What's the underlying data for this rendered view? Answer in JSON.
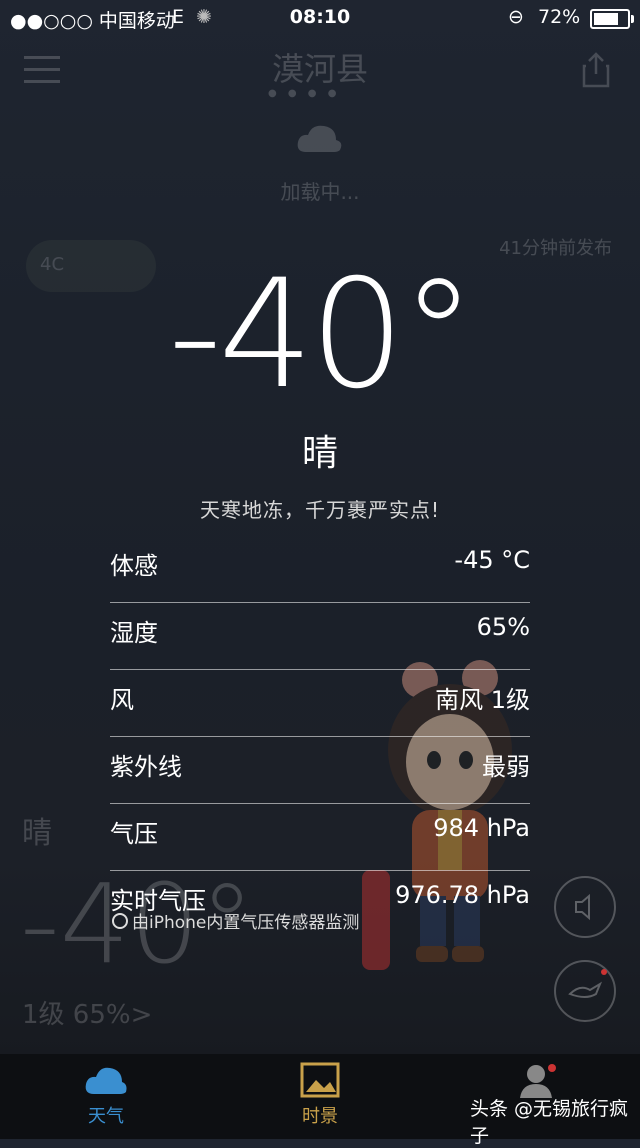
{
  "status_bar": {
    "carrier": "●●○○○ 中国移动",
    "network": "E",
    "time": "08:10",
    "battery": "72%"
  },
  "header": {
    "city": "漠河县",
    "loading": "加载中...",
    "published": "41分钟前发布",
    "aqi": "4C"
  },
  "current": {
    "temperature": "-40°",
    "condition": "晴",
    "tip": "天寒地冻，千万裹严实点!"
  },
  "details": [
    {
      "label": "体感",
      "value": "-45 °C"
    },
    {
      "label": "湿度",
      "value": "65%"
    },
    {
      "label": "风",
      "value": "南风 1级"
    },
    {
      "label": "紫外线",
      "value": "最弱"
    },
    {
      "label": "气压",
      "value": "984 hPa"
    },
    {
      "label": "实时气压",
      "value": "976.78 hPa"
    }
  ],
  "sensor_note": "由iPhone内置气压传感器监测",
  "background_widget": {
    "condition": "晴",
    "temperature": "-40°",
    "stats": "1级   65%>"
  },
  "tabs": [
    {
      "label": "天气",
      "color": "#3a8fd0"
    },
    {
      "label": "时景",
      "color": "#c9a14a"
    },
    {
      "label": "",
      "color": "#888888"
    }
  ],
  "watermark": "头条 @无锡旅行疯子"
}
